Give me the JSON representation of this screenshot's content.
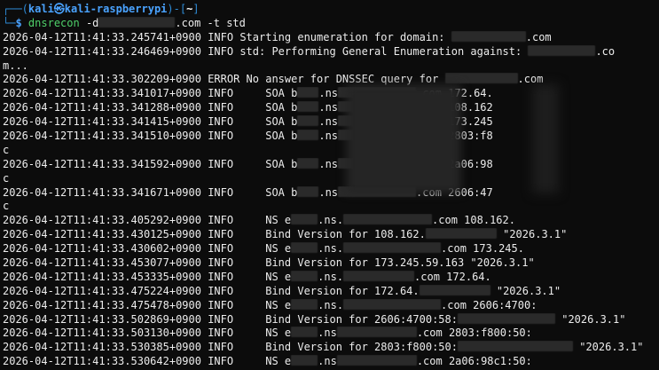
{
  "prompt": {
    "frame_top": "┌──(",
    "user_host": "kali㉿kali-raspberrypi",
    "dir_open": ")-[",
    "dir": "~",
    "dir_close": "]",
    "frame_bottom": "└─",
    "dollar": "$",
    "command": "dnsrecon",
    "args_pre": " -d",
    "args_post": ".com -t std"
  },
  "lines": [
    {
      "ts": "2026-04-12T11:41:33.245741+0900",
      "level": "INFO",
      "pre": " Starting enumeration for domain: ",
      "post": ".com"
    },
    {
      "ts": "2026-04-12T11:41:33.246469+0900",
      "level": "INFO",
      "pre": " std: Performing General Enumeration against: ",
      "post": ".co"
    },
    {
      "text": "m..."
    },
    {
      "ts": "2026-04-12T11:41:33.302209+0900",
      "level": "ERROR",
      "pre": " No answer for DNSSEC query for ",
      "post": ".com"
    },
    {
      "ts": "2026-04-12T11:41:33.341017+0900",
      "level": "INFO",
      "pre": "     SOA b",
      "mid": ".ns",
      "post": ".com 172.64."
    },
    {
      "ts": "2026-04-12T11:41:33.341288+0900",
      "level": "INFO",
      "pre": "     SOA b",
      "mid": ".ns",
      "post": ".com 108.162"
    },
    {
      "ts": "2026-04-12T11:41:33.341415+0900",
      "level": "INFO",
      "pre": "     SOA b",
      "mid": ".ns",
      "post": ".com 173.245"
    },
    {
      "ts": "2026-04-12T11:41:33.341510+0900",
      "level": "INFO",
      "pre": "     SOA b",
      "mid": ".ns",
      "post": ".com 2803:f8"
    },
    {
      "text": "c"
    },
    {
      "ts": "2026-04-12T11:41:33.341592+0900",
      "level": "INFO",
      "pre": "     SOA b",
      "mid": ".ns",
      "post": ".com 2a06:98"
    },
    {
      "text": "c"
    },
    {
      "ts": "2026-04-12T11:41:33.341671+0900",
      "level": "INFO",
      "pre": "     SOA b",
      "mid": ".ns",
      "post": ".com 2606:47"
    },
    {
      "text": "c"
    },
    {
      "ts": "2026-04-12T11:41:33.405292+0900",
      "level": "INFO",
      "pre": "     NS e",
      "mid": ".ns.",
      "post": ".com 108.162."
    },
    {
      "ts": "2026-04-12T11:41:33.430125+0900",
      "level": "INFO",
      "pre": "     Bind Version for 108.162.",
      "post": "\"2026.3.1\""
    },
    {
      "ts": "2026-04-12T11:41:33.430602+0900",
      "level": "INFO",
      "pre": "     NS e",
      "mid": ".ns.",
      "post": ".com 173.245."
    },
    {
      "ts": "2026-04-12T11:41:33.453077+0900",
      "level": "INFO",
      "pre": "     Bind Version for 173.245.59.163 \"2026.3.1\"",
      "post": ""
    },
    {
      "ts": "2026-04-12T11:41:33.453335+0900",
      "level": "INFO",
      "pre": "     NS e",
      "mid": ".ns.",
      "post": ".com 172.64."
    },
    {
      "ts": "2026-04-12T11:41:33.475224+0900",
      "level": "INFO",
      "pre": "     Bind Version for 172.64.",
      "post": "\"2026.3.1\""
    },
    {
      "ts": "2026-04-12T11:41:33.475478+0900",
      "level": "INFO",
      "pre": "     NS e",
      "mid": ".ns.",
      "post": ".com 2606:4700:"
    },
    {
      "ts": "2026-04-12T11:41:33.502869+0900",
      "level": "INFO",
      "pre": "     Bind Version for 2606:4700:58:",
      "post": "\"2026.3.1\""
    },
    {
      "ts": "2026-04-12T11:41:33.503130+0900",
      "level": "INFO",
      "pre": "     NS e",
      "mid": ".ns",
      "post": ".com 2803:f800:50:"
    },
    {
      "ts": "2026-04-12T11:41:33.530385+0900",
      "level": "INFO",
      "pre": "     Bind Version for 2803:f800:50:",
      "post": "\"2026.3.1\""
    },
    {
      "ts": "2026-04-12T11:41:33.530642+0900",
      "level": "INFO",
      "pre": "     NS e",
      "mid": ".ns",
      "post": ".com 2a06:98c1:50:"
    }
  ],
  "colors": {
    "background": "#0c0c0c",
    "text": "#ececec",
    "prompt_blue": "#4aa3ff",
    "command_green": "#4fd16a"
  }
}
